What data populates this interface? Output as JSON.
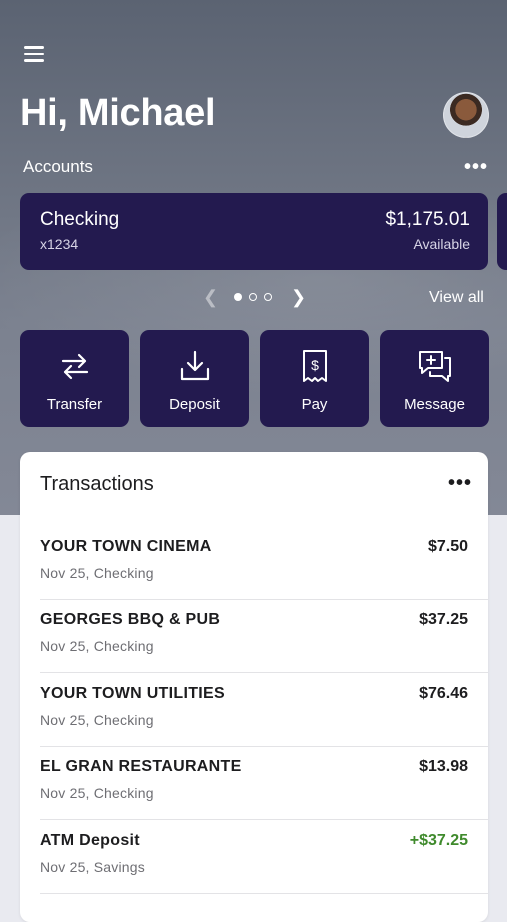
{
  "header": {
    "menu_icon": "hamburger-menu-icon",
    "greeting": "Hi, Michael",
    "avatar_icon": "user-avatar"
  },
  "accounts": {
    "label": "Accounts",
    "more_icon": "more-horizontal-icon",
    "card": {
      "name": "Checking",
      "number": "x1234",
      "balance": "$1,175.01",
      "balance_label": "Available"
    },
    "pager": {
      "total": 3,
      "active": 1
    },
    "view_all": "View all"
  },
  "actions": [
    {
      "label": "Transfer",
      "icon": "transfer-arrows-icon"
    },
    {
      "label": "Deposit",
      "icon": "deposit-download-icon"
    },
    {
      "label": "Pay",
      "icon": "pay-bill-icon"
    },
    {
      "label": "Message",
      "icon": "message-plus-icon"
    }
  ],
  "transactions": {
    "title": "Transactions",
    "more_icon": "more-horizontal-icon",
    "items": [
      {
        "name": "YOUR TOWN CINEMA",
        "meta": "Nov 25, Checking",
        "amount": "$7.50",
        "positive": false
      },
      {
        "name": "GEORGES BBQ & PUB",
        "meta": "Nov 25, Checking",
        "amount": "$37.25",
        "positive": false
      },
      {
        "name": "YOUR TOWN UTILITIES",
        "meta": "Nov 25, Checking",
        "amount": "$76.46",
        "positive": false
      },
      {
        "name": "EL GRAN RESTAURANTE",
        "meta": "Nov 25, Checking",
        "amount": "$13.98",
        "positive": false
      },
      {
        "name": "ATM Deposit",
        "meta": "Nov 25, Savings",
        "amount": "+$37.25",
        "positive": true
      }
    ]
  },
  "colors": {
    "card_bg": "#231a4f",
    "positive_amount": "#3f8a2c"
  }
}
